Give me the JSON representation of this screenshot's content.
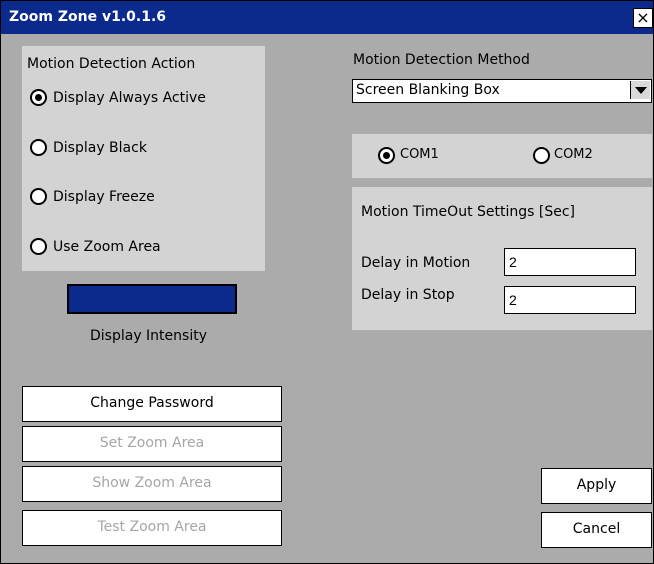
{
  "window": {
    "title": "Zoom Zone v1.0.1.6",
    "close_glyph": "×"
  },
  "action_panel": {
    "heading": "Motion Detection Action",
    "options": [
      {
        "label": "Display Always Active",
        "selected": true
      },
      {
        "label": "Display Black",
        "selected": false
      },
      {
        "label": "Display Freeze",
        "selected": false
      },
      {
        "label": "Use Zoom Area",
        "selected": false
      }
    ]
  },
  "intensity": {
    "label": "Display Intensity",
    "color": "#0b2a8c"
  },
  "method": {
    "label": "Motion Detection Method",
    "selected": "Screen Blanking Box"
  },
  "ports": {
    "com1": "COM1",
    "com2": "COM2",
    "selected": "COM1"
  },
  "timeout": {
    "heading": "Motion TimeOut Settings [Sec]",
    "delay_motion_label": "Delay in Motion",
    "delay_motion_value": "2",
    "delay_stop_label": "Delay in Stop",
    "delay_stop_value": "2"
  },
  "buttons": {
    "change_password": "Change Password",
    "set_zoom": "Set Zoom Area",
    "show_zoom": "Show Zoom Area",
    "test_zoom": "Test Zoom Area",
    "apply": "Apply",
    "cancel": "Cancel"
  }
}
